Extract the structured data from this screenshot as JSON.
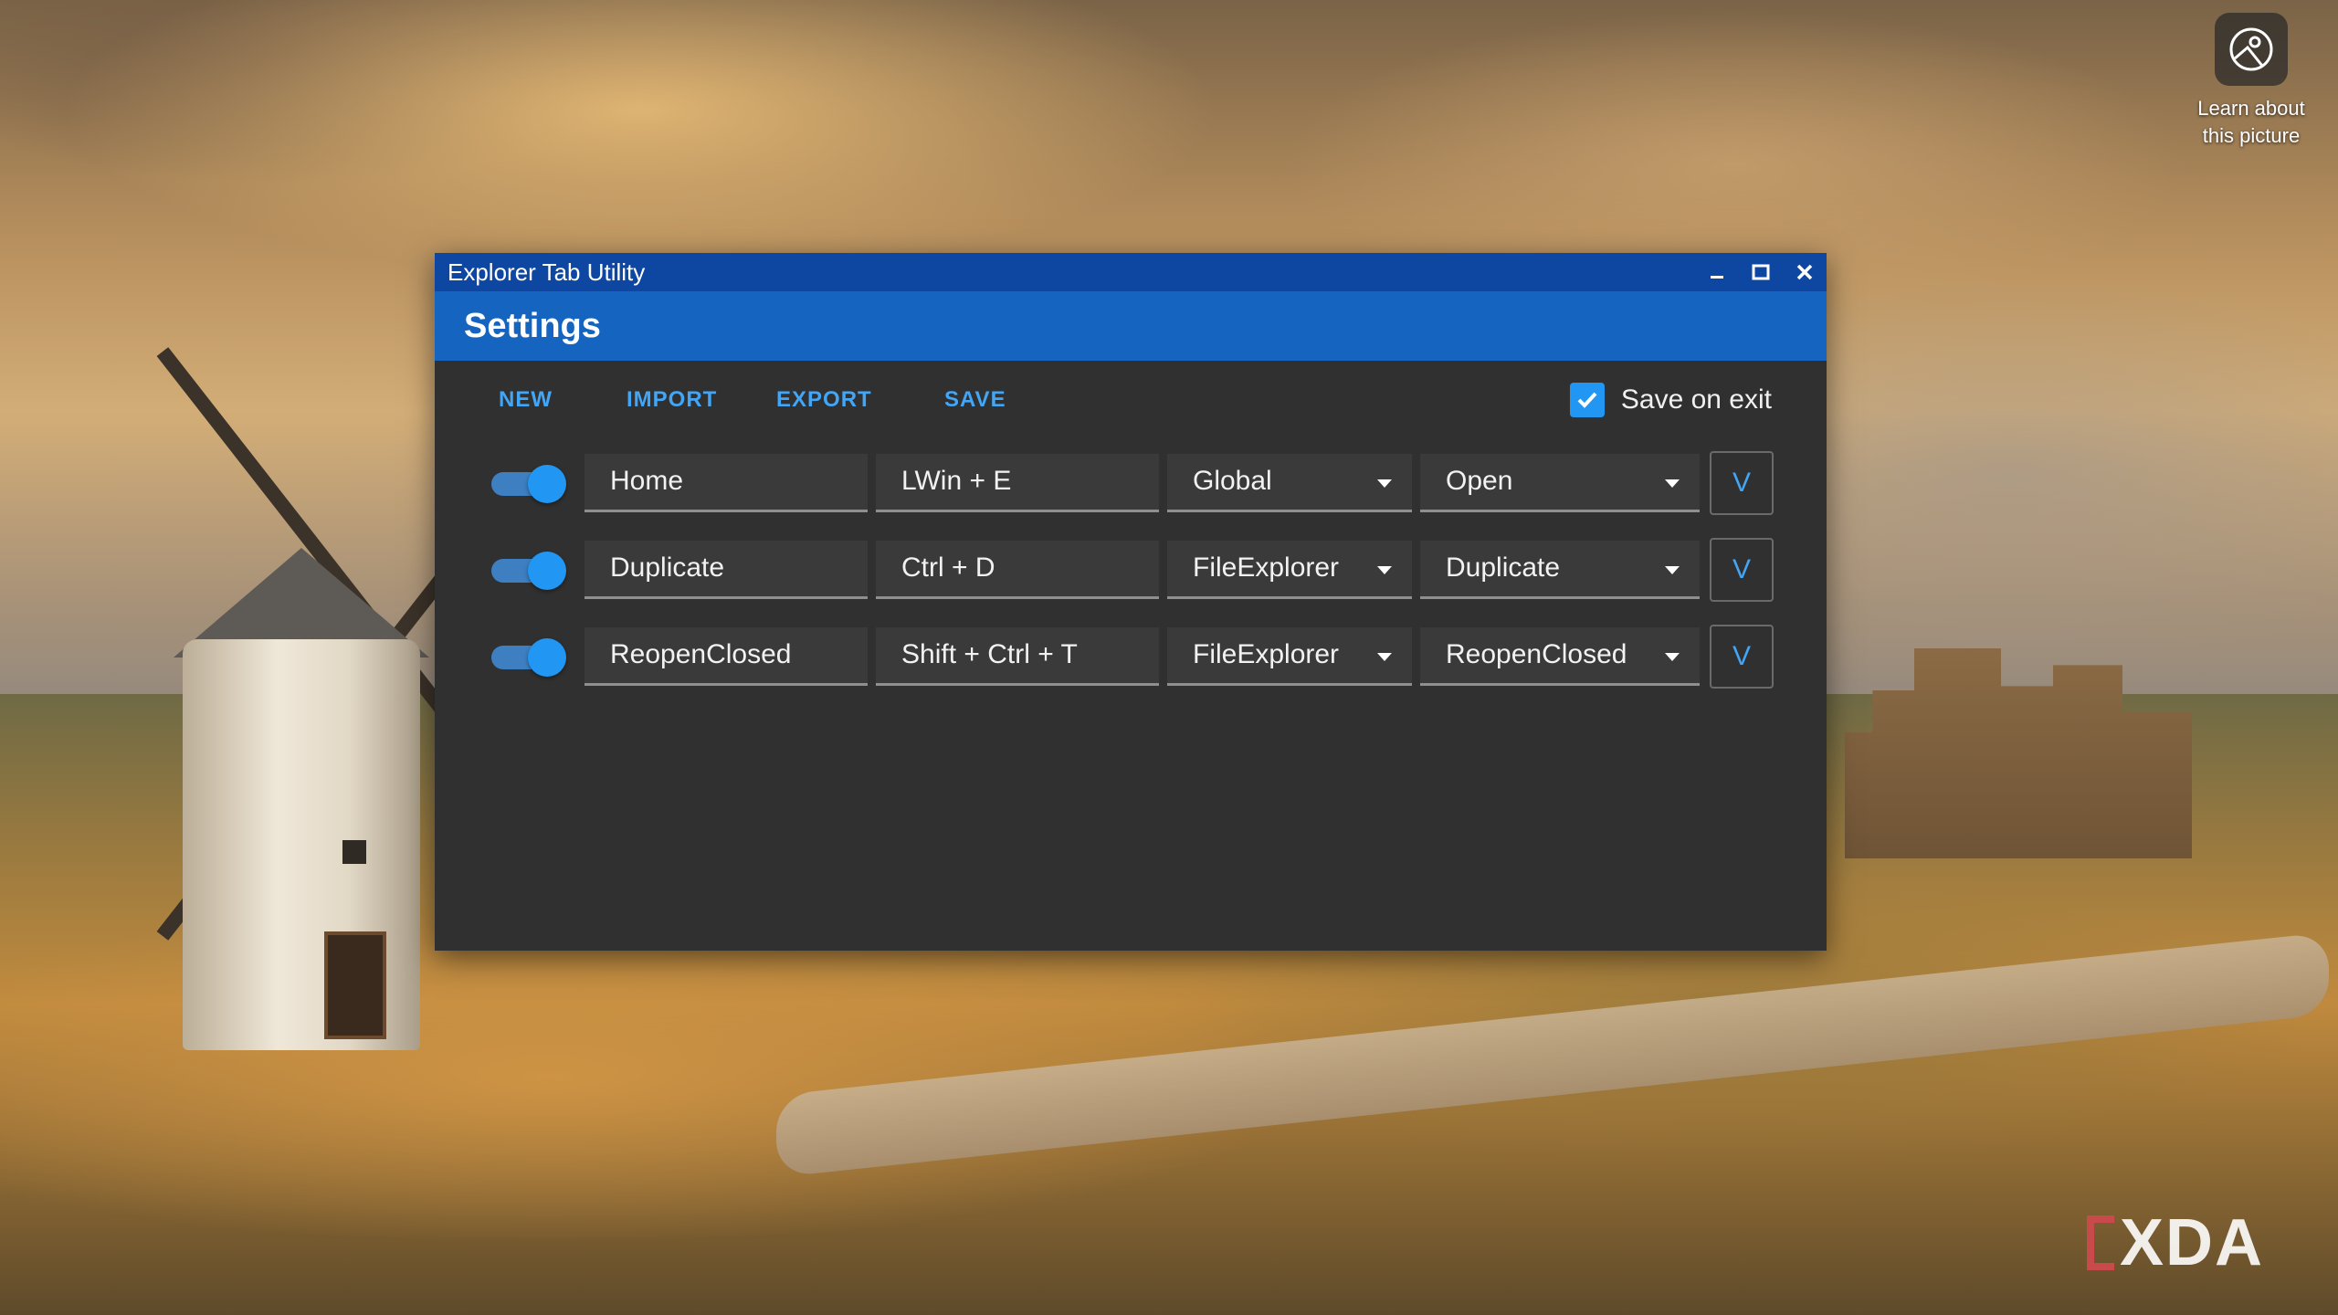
{
  "desktop": {
    "learn_label_line1": "Learn about",
    "learn_label_line2": "this picture",
    "watermark": "XDA"
  },
  "window": {
    "title": "Explorer Tab Utility",
    "header": "Settings",
    "toolbar": {
      "new_label": "NEW",
      "import_label": "IMPORT",
      "export_label": "EXPORT",
      "save_label": "SAVE"
    },
    "save_on_exit": {
      "label": "Save on exit",
      "checked": true
    },
    "expand_glyph": "V",
    "rows": [
      {
        "enabled": true,
        "name": "Home",
        "hotkey": "LWin + E",
        "scope": "Global",
        "action": "Open"
      },
      {
        "enabled": true,
        "name": "Duplicate",
        "hotkey": "Ctrl + D",
        "scope": "FileExplorer",
        "action": "Duplicate"
      },
      {
        "enabled": true,
        "name": "ReopenClosed",
        "hotkey": "Shift + Ctrl + T",
        "scope": "FileExplorer",
        "action": "ReopenClosed"
      }
    ]
  },
  "colors": {
    "titlebar": "#0d47a1",
    "header": "#1565c0",
    "accent": "#2196f3",
    "link": "#42a5f5",
    "content_bg": "#303030"
  }
}
